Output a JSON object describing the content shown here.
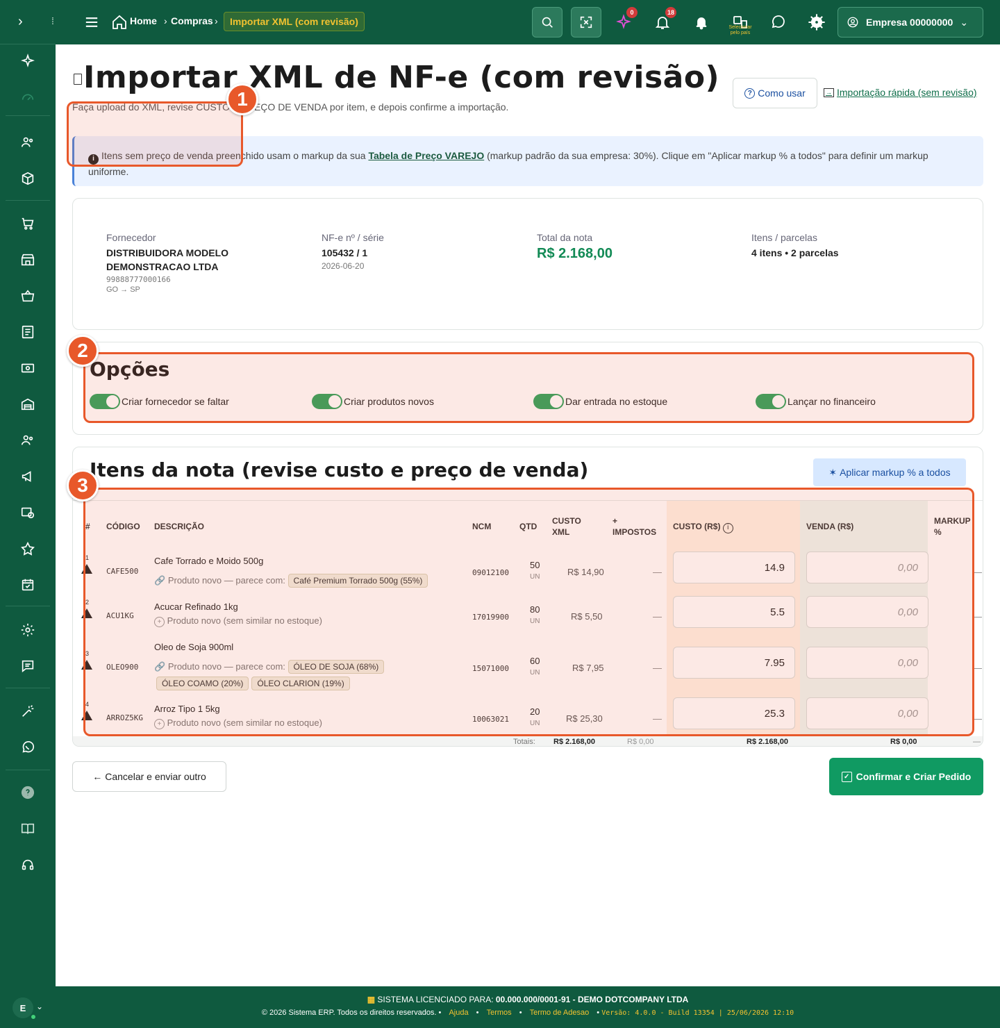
{
  "topbar": {
    "breadcrumb": [
      "Home",
      "Compras",
      "Importar XML (com revisão)"
    ],
    "notif_ai_badge": "0",
    "notif_bell_badge": "18",
    "small_label": "Selecionar pelo país",
    "company": "Empresa 00000000"
  },
  "page": {
    "title": "Importar XML de NF-e (com revisão)",
    "subtitle": "Faça upload do XML, revise CUSTO e PREÇO DE VENDA por item, e depois confirme a importação.",
    "how_to": "Como usar",
    "quick_import": "Importação rápida (sem revisão)"
  },
  "info": {
    "text_before": "Itens sem preço de venda preenchido usam o markup da sua",
    "link": "Tabela de Preço VAREJO",
    "text_after": "(markup padrão da sua empresa: 30%). Clique em \"Aplicar markup % a todos\" para definir um markup uniforme."
  },
  "summary": {
    "supplier_label": "Fornecedor",
    "supplier_name": "DISTRIBUIDORA MODELO DEMONSTRACAO LTDA",
    "supplier_doc": "99888777000166",
    "supplier_route": "GO → SP",
    "nfe_label": "NF-e nº / série",
    "nfe_value": "105432 / 1",
    "nfe_date": "2026-06-20",
    "total_label": "Total da nota",
    "total_value": "R$ 2.168,00",
    "items_label": "Itens / parcelas",
    "items_value": "4 itens • 2 parcelas"
  },
  "options": {
    "title": "Opções",
    "items": [
      "Criar fornecedor se faltar",
      "Criar produtos novos",
      "Dar entrada no estoque",
      "Lançar no financeiro"
    ]
  },
  "items": {
    "title": "Itens da nota (revise custo e preço de venda)",
    "markup_button": "Aplicar markup % a todos",
    "headers": {
      "num": "#",
      "code": "CÓDIGO",
      "desc": "DESCRIÇÃO",
      "ncm": "NCM",
      "qty": "QTD",
      "cost_xml": "CUSTO XML",
      "taxes": "+ IMPOSTOS",
      "cost": "CUSTO (R$)",
      "sale": "VENDA (R$)",
      "markup": "MARKUP %"
    },
    "rows": [
      {
        "num": "1",
        "code": "CAFE500",
        "desc": "Cafe Torrado e Moido 500g",
        "hint": "Produto novo — parece com:",
        "chips": [
          "Café Premium Torrado 500g (55%)"
        ],
        "ncm": "09012100",
        "qty": "50",
        "unit": "UN",
        "cost_xml": "R$ 14,90",
        "taxes": "—",
        "cost": "14.9",
        "sale": "0,00",
        "markup": "—"
      },
      {
        "num": "2",
        "code": "ACU1KG",
        "desc": "Acucar Refinado 1kg",
        "hint": "Produto novo (sem similar no estoque)",
        "chips": [],
        "ncm": "17019900",
        "qty": "80",
        "unit": "UN",
        "cost_xml": "R$ 5,50",
        "taxes": "—",
        "cost": "5.5",
        "sale": "0,00",
        "markup": "—"
      },
      {
        "num": "3",
        "code": "OLEO900",
        "desc": "Oleo de Soja 900ml",
        "hint": "Produto novo — parece com:",
        "chips": [
          "ÓLEO DE SOJA (68%)",
          "ÓLEO COAMO (20%)",
          "ÓLEO CLARION (19%)"
        ],
        "ncm": "15071000",
        "qty": "60",
        "unit": "UN",
        "cost_xml": "R$ 7,95",
        "taxes": "—",
        "cost": "7.95",
        "sale": "0,00",
        "markup": "—"
      },
      {
        "num": "4",
        "code": "ARROZ5KG",
        "desc": "Arroz Tipo 1 5kg",
        "hint": "Produto novo (sem similar no estoque)",
        "chips": [],
        "ncm": "10063021",
        "qty": "20",
        "unit": "UN",
        "cost_xml": "R$ 25,30",
        "taxes": "—",
        "cost": "25.3",
        "sale": "0,00",
        "markup": "—"
      }
    ],
    "totals": {
      "label": "Totais:",
      "cost_xml": "R$ 2.168,00",
      "taxes": "R$ 0,00",
      "cost": "R$ 2.168,00",
      "sale": "R$ 0,00",
      "markup": "—"
    }
  },
  "actions": {
    "cancel": "Cancelar e enviar outro",
    "confirm": "Confirmar e Criar Pedido"
  },
  "callouts": [
    "1",
    "2",
    "3"
  ],
  "sidebar": {
    "avatar": "E"
  },
  "footer": {
    "license_label": "SISTEMA LICENCIADO PARA:",
    "license_value": "00.000.000/0001-91 - DEMO DOTCOMPANY LTDA",
    "copyright": "© 2026 Sistema ERP. Todos os direitos reservados.",
    "links": [
      "Ajuda",
      "Termos",
      "Termo de Adesao"
    ],
    "version": "Versão: 4.0.0 - Build 13354 | 25/06/2026 12:10"
  },
  "colors": {
    "brand": "#0f5a3f",
    "accent": "#109a62",
    "callout": "#e8582a",
    "warning_text": "#f2c230"
  }
}
